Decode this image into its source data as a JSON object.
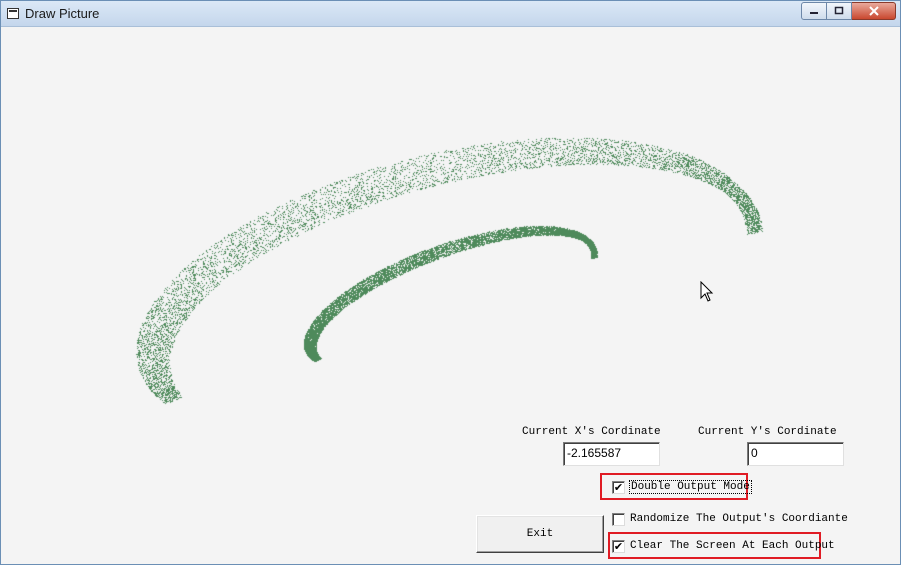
{
  "window": {
    "title": "Draw Picture",
    "icon": "window-icon",
    "controls": {
      "minimize": "0",
      "maximize": "1",
      "close": "r"
    }
  },
  "cursor": {
    "icon": "mouse-pointer-icon"
  },
  "drawing": {
    "point_color": "#4e8a5b"
  },
  "coords": {
    "x_label": "Current X's Cordinate",
    "x_value": "-2.165587",
    "y_label": "Current Y's Cordinate",
    "y_value": "0"
  },
  "options": {
    "double_output": {
      "label": "Double Output Mode",
      "checked": true
    },
    "randomize": {
      "label": "Randomize The Output's Coordiante",
      "checked": false
    },
    "clear_screen": {
      "label": "Clear The Screen At Each Output",
      "checked": true
    }
  },
  "buttons": {
    "exit": "Exit"
  },
  "colors": {
    "highlight": "#e01b24",
    "titlebar": "#c4d6ec",
    "client": "#f4f4f4"
  }
}
